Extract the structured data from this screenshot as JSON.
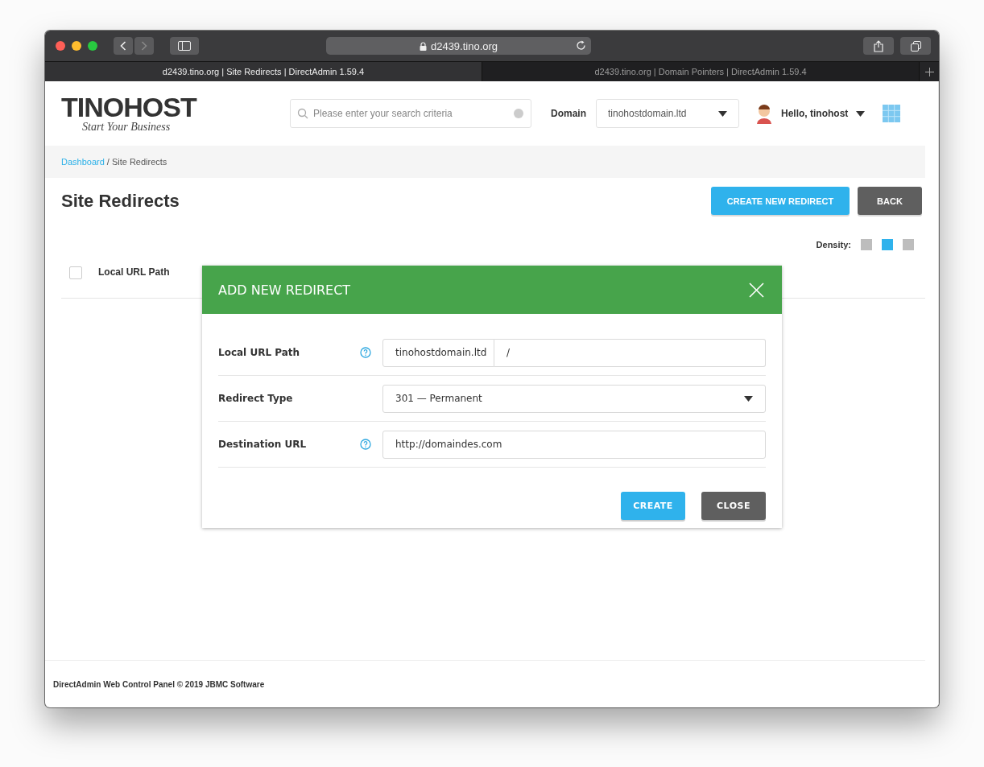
{
  "browser": {
    "address": "d2439.tino.org",
    "tabs": [
      {
        "title": "d2439.tino.org | Site Redirects | DirectAdmin 1.59.4",
        "selected": true
      },
      {
        "title": "d2439.tino.org | Domain Pointers | DirectAdmin 1.59.4",
        "selected": false
      }
    ]
  },
  "header": {
    "logo": "TINOHOST",
    "tagline": "Start Your Business",
    "search_placeholder": "Please enter your search criteria",
    "domain_label": "Domain",
    "domain_value": "tinohostdomain.ltd",
    "greeting": "Hello, tinohost"
  },
  "breadcrumb": {
    "link": "Dashboard",
    "separator": "/",
    "current": "Site Redirects"
  },
  "page": {
    "title": "Site Redirects",
    "buttons": [
      {
        "label": "CREATE NEW REDIRECT",
        "kind": "primary"
      },
      {
        "label": "BACK",
        "kind": "secondary"
      }
    ],
    "density_label": "Density:",
    "density_options": [
      {
        "selected": false
      },
      {
        "selected": true
      },
      {
        "selected": false
      }
    ],
    "table": {
      "select_all_checked": false,
      "columns": [
        "Local URL Path"
      ]
    }
  },
  "modal": {
    "title": "ADD NEW REDIRECT",
    "fields": [
      {
        "label": "Local URL Path",
        "help": true,
        "kind": "split",
        "prefix": "tinohostdomain.ltd",
        "value": "/"
      },
      {
        "label": "Redirect Type",
        "help": false,
        "kind": "select",
        "value": "301 — Permanent"
      },
      {
        "label": "Destination URL",
        "help": true,
        "kind": "text",
        "value": "http://domaindes.com"
      }
    ],
    "buttons": [
      {
        "label": "CREATE",
        "kind": "primary"
      },
      {
        "label": "CLOSE",
        "kind": "secondary"
      }
    ]
  },
  "footer": "DirectAdmin Web Control Panel © 2019 JBMC Software"
}
